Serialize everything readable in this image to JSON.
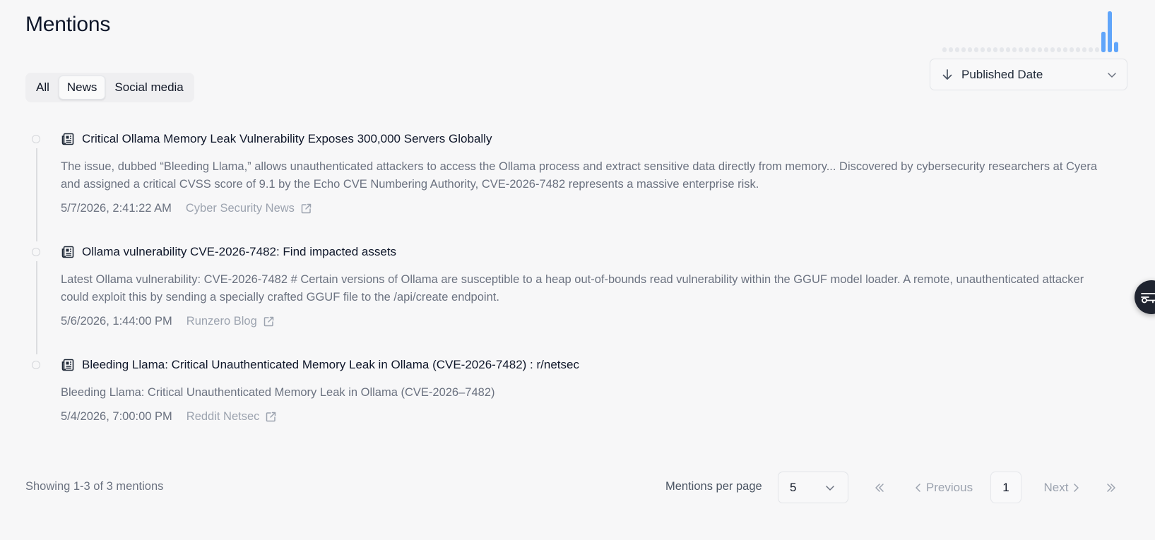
{
  "header": {
    "title": "Mentions"
  },
  "activity_sparkline": {
    "values": [
      0,
      0,
      0,
      0,
      0,
      0,
      0,
      0,
      0,
      0,
      0,
      0,
      0,
      0,
      0,
      0,
      0,
      0,
      0,
      0,
      0,
      0,
      0,
      0,
      0,
      1,
      2,
      0.5
    ]
  },
  "tabs": [
    {
      "label": "All",
      "active": false
    },
    {
      "label": "News",
      "active": true
    },
    {
      "label": "Social media",
      "active": false
    }
  ],
  "sort": {
    "label": "Published Date",
    "icon": "arrow-down-icon"
  },
  "mentions": [
    {
      "title": "Critical Ollama Memory Leak Vulnerability Exposes 300,000 Servers Globally",
      "description": "The issue, dubbed “Bleeding Llama,” allows unauthenticated attackers to access the Ollama process and extract sensitive data directly from memory... Discovered by cybersecurity researchers at Cyera and assigned a critical CVSS score of 9.1 by the Echo CVE Numbering Authority, CVE-2026-7482 represents a massive enterprise risk.",
      "date": "5/7/2026, 2:41:22 AM",
      "source": "Cyber Security News"
    },
    {
      "title": "Ollama vulnerability CVE-2026-7482: Find impacted assets",
      "description": "Latest Ollama vulnerability: CVE-2026-7482 # Certain versions of Ollama are susceptible to a heap out-of-bounds read vulnerability within the GGUF model loader. A remote, unauthenticated attacker could exploit this by sending a specially crafted GGUF file to the /api/create endpoint.",
      "date": "5/6/2026, 1:44:00 PM",
      "source": "Runzero Blog"
    },
    {
      "title": "Bleeding Llama: Critical Unauthenticated Memory Leak in Ollama (CVE-2026-7482) : r/netsec",
      "description": "Bleeding Llama: Critical Unauthenticated Memory Leak in Ollama (CVE-2026–7482)",
      "date": "5/4/2026, 7:00:00 PM",
      "source": "Reddit Netsec"
    }
  ],
  "footer": {
    "showing": "Showing 1-3 of 3 mentions",
    "per_page_label": "Mentions per page",
    "per_page_value": "5",
    "previous": "Previous",
    "next": "Next",
    "current_page": "1"
  },
  "colors": {
    "accent": "#60a5fa",
    "spark_idle": "#e5e7eb"
  }
}
